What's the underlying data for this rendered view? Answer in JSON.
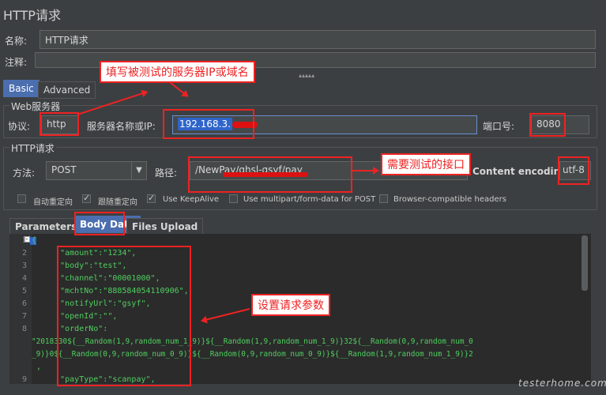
{
  "header": {
    "title": "HTTP请求"
  },
  "name_row": {
    "label": "名称:",
    "value": "HTTP请求"
  },
  "comment_row": {
    "label": "注释:"
  },
  "tabs": {
    "basic": "Basic",
    "advanced": "Advanced"
  },
  "web_server": {
    "group_title": "Web服务器",
    "protocol_label": "协议:",
    "protocol_value": "http",
    "server_label": "服务器名称或IP:",
    "server_value": "192.168.3.",
    "port_label": "端口号:",
    "port_value": "8080"
  },
  "http_request": {
    "group_title": "HTTP请求",
    "method_label": "方法:",
    "method_value": "POST",
    "path_label": "路径:",
    "path_value": "/NewPay/ghsl-gsyf/pay",
    "encoding_label": "Content encoding:",
    "encoding_value": "utf-8"
  },
  "checkboxes": [
    {
      "label": "自动重定向",
      "checked": false
    },
    {
      "label": "跟随重定向",
      "checked": true
    },
    {
      "label": "Use KeepAlive",
      "checked": true
    },
    {
      "label": "Use multipart/form-data for POST",
      "checked": false
    },
    {
      "label": "Browser-compatible headers",
      "checked": false
    }
  ],
  "sub_tabs": {
    "parameters": "Parameters",
    "body_data": "Body Data",
    "files_upload": "Files Upload"
  },
  "code_lines": [
    {
      "num": "1",
      "text": "{"
    },
    {
      "num": "2",
      "text": "      \"amount\":\"1234\","
    },
    {
      "num": "3",
      "text": "      \"body\":\"test\","
    },
    {
      "num": "4",
      "text": "      \"channel\":\"00001000\","
    },
    {
      "num": "5",
      "text": "      \"mchtNo\":\"888584054110906\","
    },
    {
      "num": "6",
      "text": "      \"notifyUrl\":\"gsyf\","
    },
    {
      "num": "7",
      "text": "      \"openId\":\"\","
    },
    {
      "num": "8",
      "text": "      \"orderNo\":"
    },
    {
      "num": "",
      "text": "\"2018330${__Random(1,9,random_num_1_9)}${__Random(1,9,random_num_1_9)}32${__Random(0,9,random_num_0"
    },
    {
      "num": "",
      "text": "_9)}0${__Random(0,9,random_num_0_9)}${__Random(0,9,random_num_0_9)}${__Random(1,9,random_num_1_9)}2"
    },
    {
      "num": "",
      "text": " ,"
    },
    {
      "num": "9",
      "text": "      \"payType\":\"scanpay\","
    }
  ],
  "annotations": {
    "server": "填写被测试的服务器IP或域名",
    "interface": "需要测试的接口",
    "params": "设置请求参数"
  },
  "watermark": "testerhome.com"
}
